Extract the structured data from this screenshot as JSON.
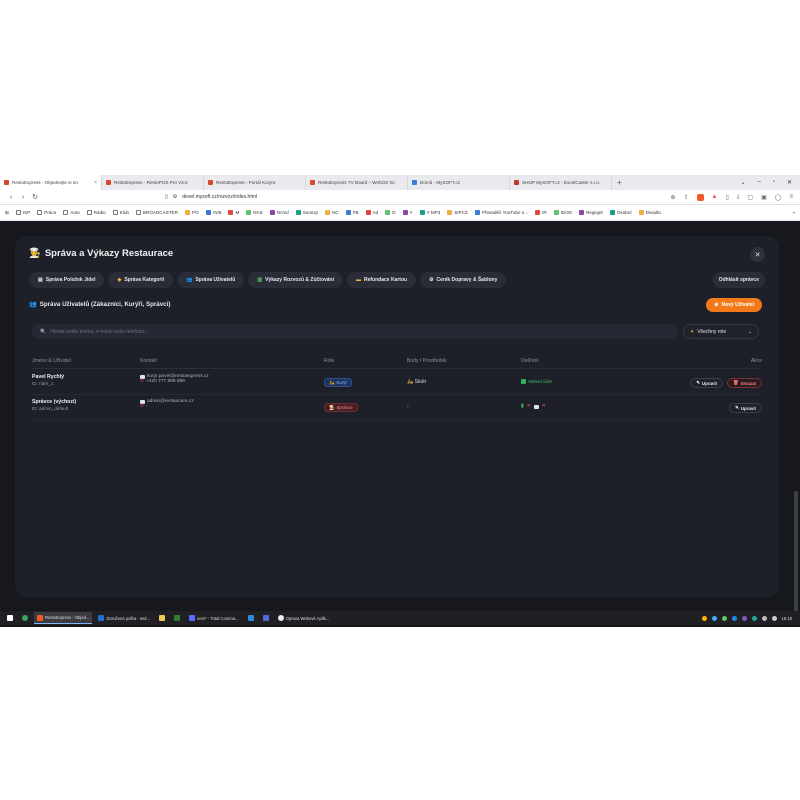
{
  "browser": {
    "tabs": [
      {
        "label": "RestoExpress - Objednejte si ön",
        "active": true
      },
      {
        "label": "RestoExpress - RestoPOS Pro V3.5",
        "active": false
      },
      {
        "label": "RestoExpress - Portál Kuryra",
        "active": false
      },
      {
        "label": "RestoExpress TV Board – WebOS ho",
        "active": false
      },
      {
        "label": "Domů - MySOFT.cz",
        "active": false
      },
      {
        "label": "SHOP MySOFT.cz - ExcelCaster s.r.o.",
        "active": false
      }
    ],
    "new_tab": "+",
    "url": "devel.mysoft.cz/rozvoz/index.html",
    "bookmarks": [
      "ISP",
      "Práce",
      "Auto",
      "Rádio",
      "Klub",
      "BROADCASTER",
      "PO",
      "AVB",
      "M",
      "NAS",
      "NASd",
      "SumUp",
      "NC",
      "FB",
      "Ad",
      "D",
      "Y",
      "Y MP3",
      "SIPCZ",
      "Převaděč YouTube n...",
      "IR",
      "IDOS",
      "Regiojet",
      "Osobní",
      "Divadlo"
    ],
    "brand_color": "#f05a28"
  },
  "modal": {
    "title": "Správa a Výkazy Restaurace",
    "title_icon": "chef-icon",
    "close": "✕",
    "nav": [
      {
        "label": "Správa Položek Jídel",
        "icon": "menu-icon"
      },
      {
        "label": "Správa Kategorií",
        "icon": "tag-icon"
      },
      {
        "label": "Správa Uživatelů",
        "icon": "users-icon"
      },
      {
        "label": "Výkazy Rozvozů & Zúčtování",
        "icon": "chart-icon"
      },
      {
        "label": "Refundace Kartou",
        "icon": "card-icon"
      },
      {
        "label": "Ceník Dopravy & Šablony",
        "icon": "gear-icon"
      }
    ],
    "logout": "Odhlásit správce"
  },
  "users_section": {
    "title": "Správa Uživatelů (Zákazníci, Kurýři, Správci)",
    "new_user": "Nový Uživatel",
    "search_placeholder": "Hledat podle jména, e-mailu nebo telefonu...",
    "role_filter": "Všechny role",
    "accent": "#f27a1a",
    "columns": [
      "Jméno & Uživatel",
      "Kontakt",
      "Role",
      "Body / Prostředek",
      "Ověření",
      "Akce"
    ],
    "rows": [
      {
        "name": "Pavel Rychlý",
        "id": "ID: rider_1",
        "email": "kuryr.pavel@restoexpress.cz",
        "phone": "+420 777 888 999",
        "role": "Kurýr",
        "vehicle": "Skútr",
        "verification": "Aktivní účet",
        "actions": [
          "Upravit",
          "Smazat"
        ]
      },
      {
        "name": "Správce (výchozí)",
        "id": "ID: admin_default",
        "email": "admin@restaurace.cz",
        "phone": "-",
        "role": "Správce",
        "vehicle": "-",
        "verification": "",
        "actions": [
          "Upravit"
        ]
      }
    ]
  },
  "taskbar": {
    "items": [
      {
        "label": "RestoExpress - Objed...",
        "active": true
      },
      {
        "label": "Doručená pošta - sed...",
        "active": false
      },
      {
        "label": "",
        "active": false
      },
      {
        "label": "",
        "active": false
      },
      {
        "label": "oem* - Total Comma...",
        "active": false
      },
      {
        "label": "",
        "active": false
      },
      {
        "label": "",
        "active": false
      },
      {
        "label": "Oprava Webové Aplik...",
        "active": false
      }
    ],
    "clock": "16:18"
  }
}
